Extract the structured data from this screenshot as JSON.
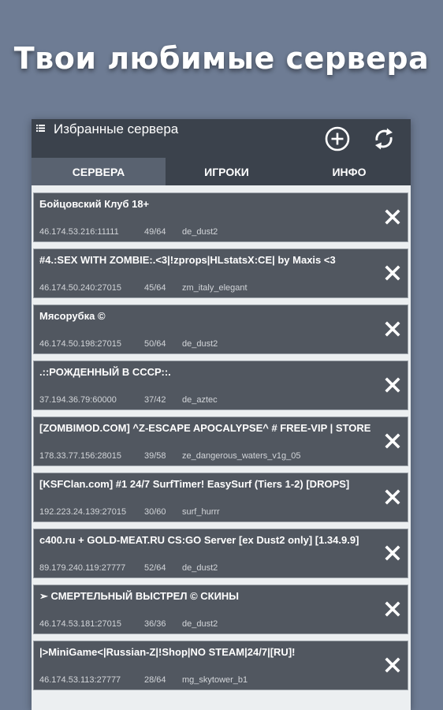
{
  "promo": {
    "headline": "Твои любимые сервера"
  },
  "appbar": {
    "title": "Избранные сервера",
    "menu_icon": "list-icon",
    "add_icon": "add-circle-icon",
    "refresh_icon": "refresh-icon"
  },
  "tabs": [
    {
      "label": "СЕРВЕРА",
      "selected": true
    },
    {
      "label": "ИГРОКИ",
      "selected": false
    },
    {
      "label": "ИНФО",
      "selected": false
    }
  ],
  "servers": [
    {
      "name": "Бойцовский Клуб 18+",
      "address": "46.174.53.216:11111",
      "players": "49/64",
      "map": "de_dust2"
    },
    {
      "name": "#4.:SEX WITH ZOMBIE:.<3|!zprops|HLstatsX:CE| by Maxis <3",
      "address": "46.174.50.240:27015",
      "players": "45/64",
      "map": "zm_italy_elegant"
    },
    {
      "name": "Мясорубка ©",
      "address": "46.174.50.198:27015",
      "players": "50/64",
      "map": "de_dust2"
    },
    {
      "name": ".::РОЖДЕННЫЙ В СССР::.",
      "address": "37.194.36.79:60000",
      "players": "37/42",
      "map": "de_aztec"
    },
    {
      "name": "[ZOMBIMOD.COM] ^Z-ESCAPE APOCALYPSE^ # FREE-VIP | STORE",
      "address": "178.33.77.156:28015",
      "players": "39/58",
      "map": "ze_dangerous_waters_v1g_05"
    },
    {
      "name": "[KSFClan.com] #1 24/7 SurfTimer! EasySurf (Tiers 1-2) [DROPS]",
      "address": "192.223.24.139:27015",
      "players": "30/60",
      "map": "surf_hurrr"
    },
    {
      "name": "c400.ru + GOLD-MEAT.RU CS:GO Server [ex Dust2 only] [1.34.9.9]",
      "address": "89.179.240.119:27777",
      "players": "52/64",
      "map": "de_dust2"
    },
    {
      "name": "➢ СМЕРТЕЛЬНЫЙ ВЫСТРЕЛ © СКИНЫ",
      "address": "46.174.53.181:27015",
      "players": "36/36",
      "map": "de_dust2"
    },
    {
      "name": "|>MiniGame<|Russian-Z|!Shop|NO STEAM|24/7|[RU]!",
      "address": "46.174.53.113:27777",
      "players": "28/64",
      "map": "mg_skytower_b1"
    }
  ],
  "remove_icon": "close-icon",
  "colors": {
    "background": "#6e7c94",
    "appbar": "#3b424c",
    "tab_selected": "#596270",
    "card": "#515760",
    "card_border": "#9ba1a8",
    "list_background": "#eceff1"
  }
}
